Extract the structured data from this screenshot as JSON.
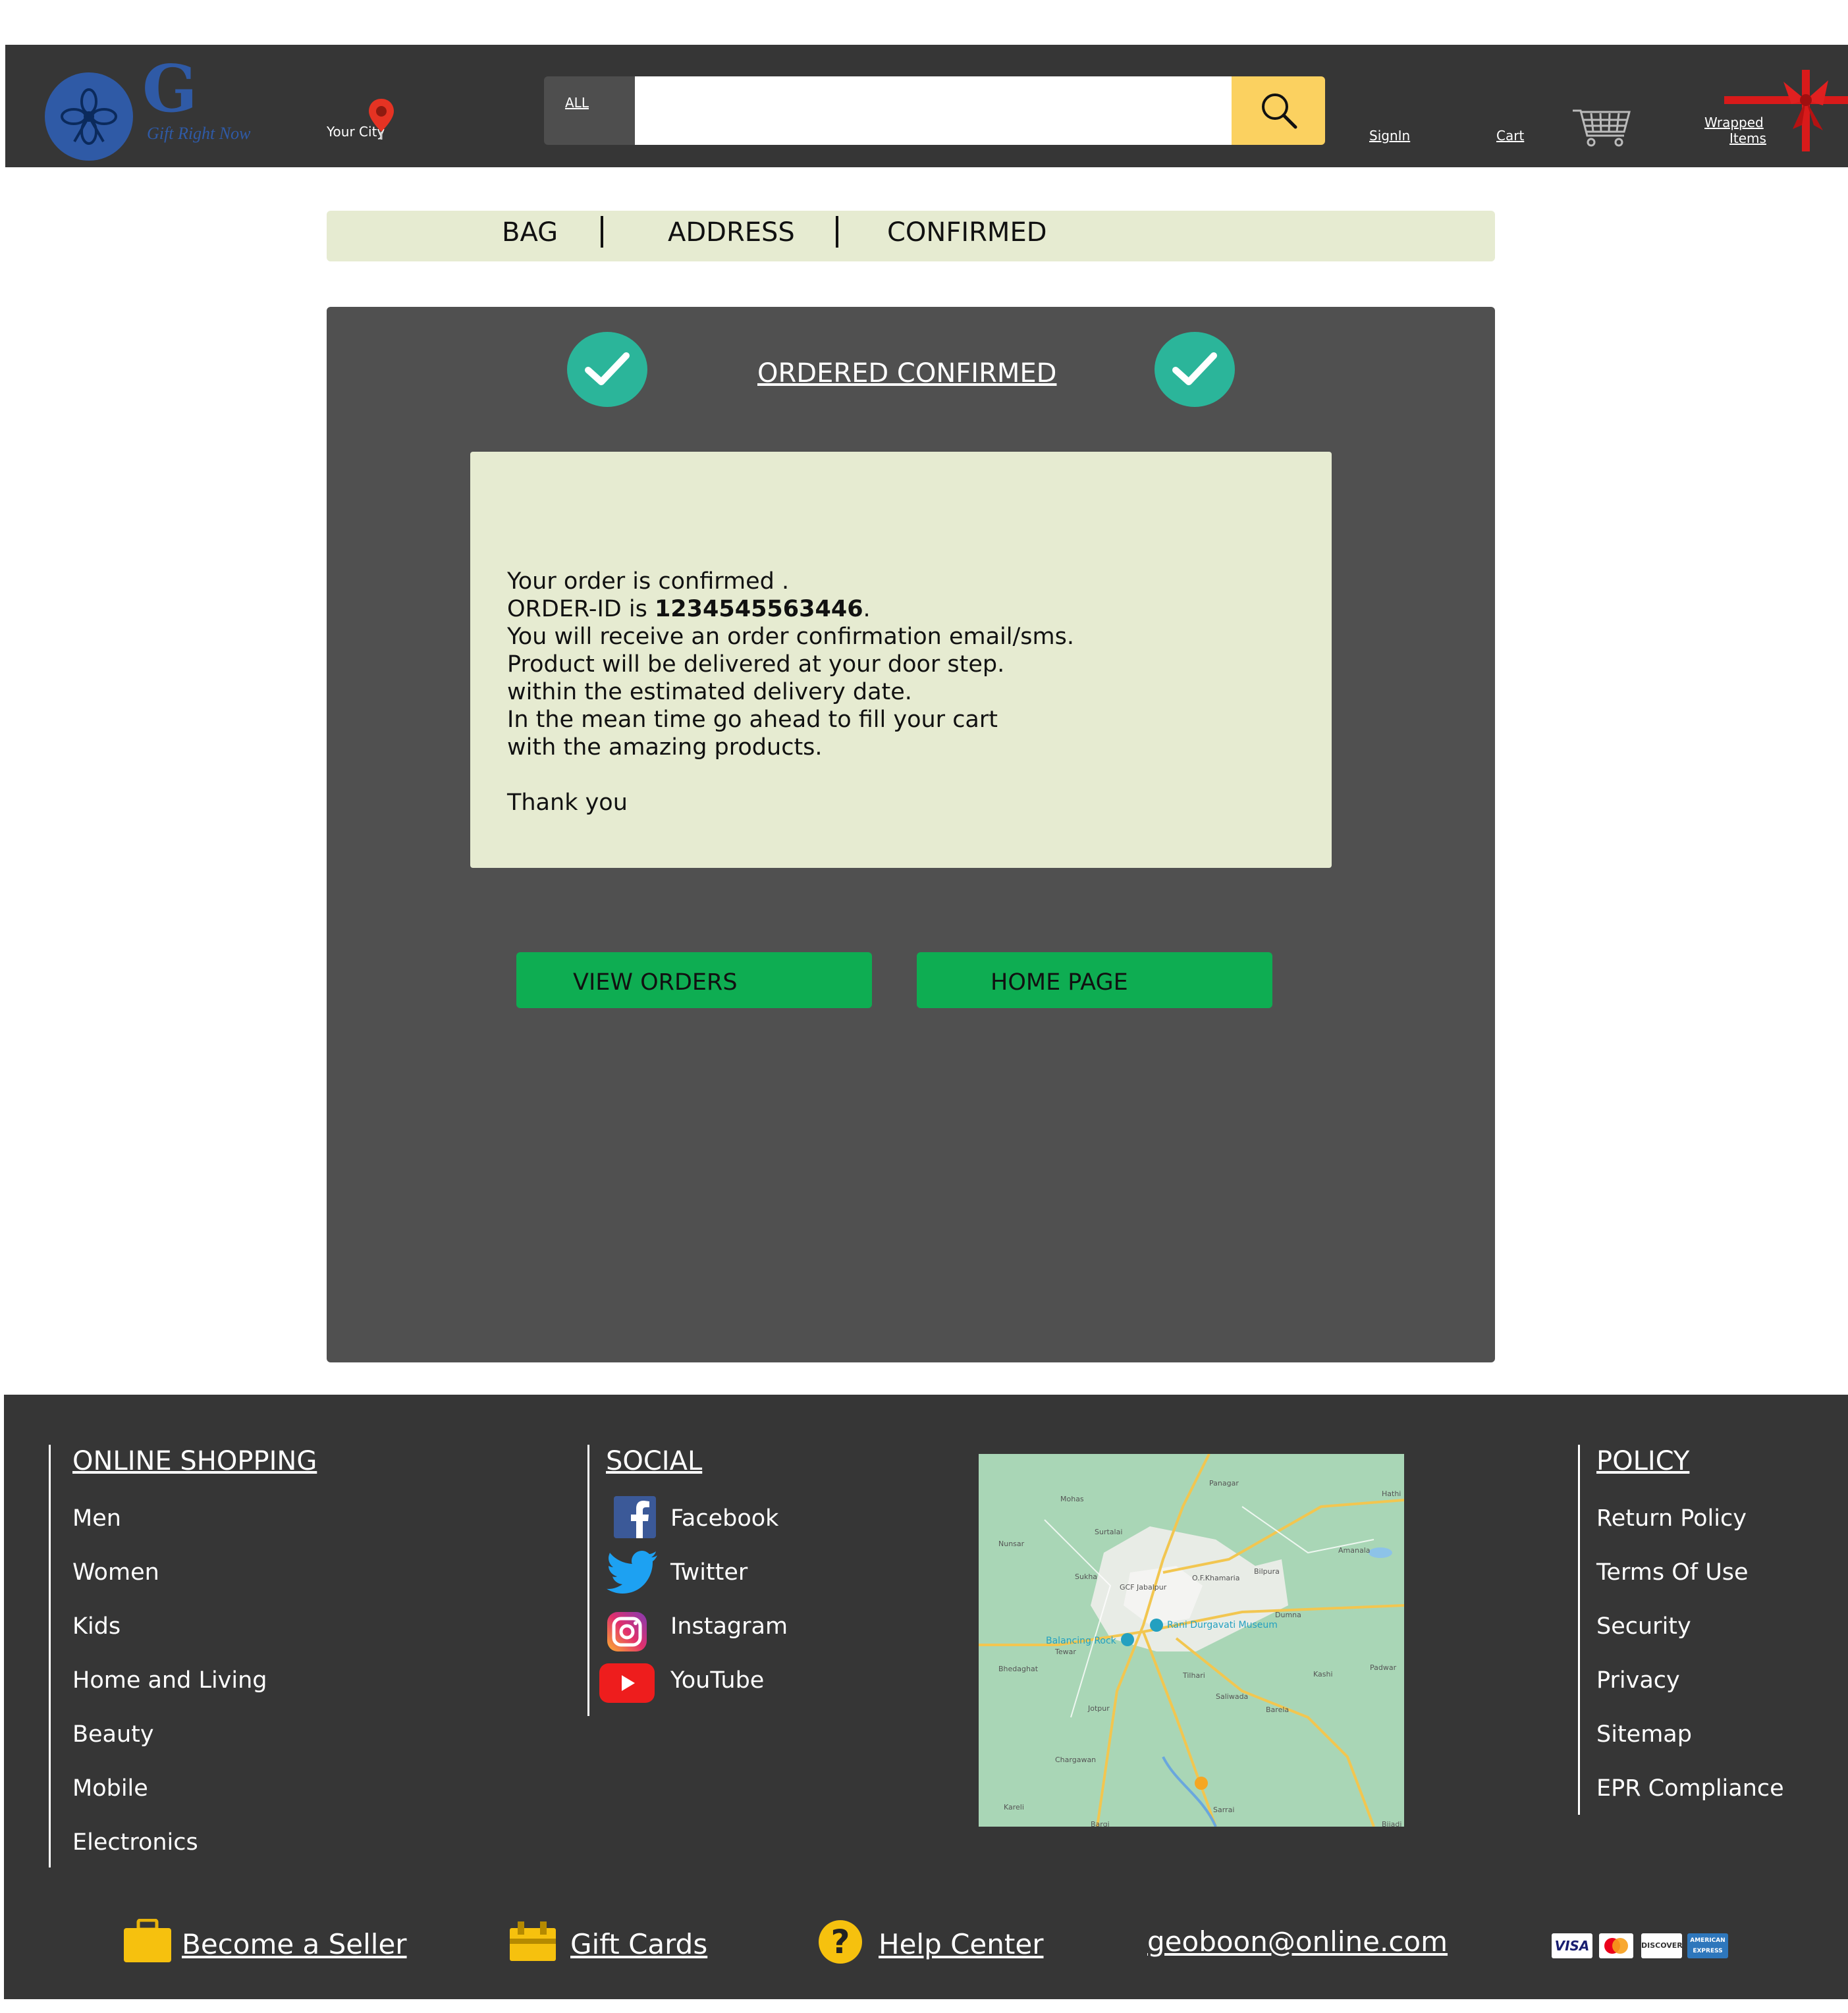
{
  "header": {
    "logo_letter": "G",
    "logo_tagline": "Gift Right Now",
    "city_label": "Your City",
    "search_category": "ALL",
    "search_value": "",
    "signin_label": "SignIn",
    "cart_label": "Cart",
    "wrapped_label_1": "Wrapped",
    "wrapped_label_2": "Items"
  },
  "stepper": {
    "steps": [
      "BAG",
      "ADDRESS",
      "CONFIRMED"
    ]
  },
  "confirmation": {
    "title": "ORDERED CONFIRMED",
    "line1": "Your order is confirmed .",
    "order_prefix": "ORDER-ID  is ",
    "order_id": "1234545563446",
    "order_suffix": ".",
    "line3": "You will receive an order confirmation email/sms.",
    "line4": "Product will be delivered at your door step.",
    "line5": "within the estimated delivery date.",
    "line6": "In the mean time go ahead to fill your cart",
    "line7": "with the amazing products.",
    "line8": "Thank you",
    "view_orders_label": "VIEW ORDERS",
    "home_page_label": "HOME PAGE"
  },
  "footer": {
    "online_shopping": {
      "heading": "ONLINE SHOPPING",
      "items": [
        "Men",
        "Women",
        "Kids",
        "Home and Living",
        "Beauty",
        "Mobile",
        "Electronics"
      ]
    },
    "social": {
      "heading": "SOCIAL",
      "items": [
        "Facebook",
        "Twitter",
        "Instagram",
        "YouTube"
      ]
    },
    "map_labels": [
      "Mohas",
      "Panagar",
      "Surtalai",
      "Nunsar",
      "Amanala",
      "Bilpura",
      "O.F.Khamaria",
      "Sukha",
      "GCF Jabalpur",
      "Dumna",
      "Rani Durgavati Museum",
      "Balancing Rock",
      "Tewar",
      "Bhedaghat",
      "Tilhari",
      "Saliwada",
      "Barela",
      "Kashi",
      "Padwar",
      "Jotpur",
      "Chargawan",
      "Kareli",
      "Sarrai",
      "Bargi",
      "Bijadi",
      "Hathi"
    ],
    "policy": {
      "heading": "POLICY",
      "items": [
        "Return Policy",
        "Terms Of Use",
        "Security",
        "Privacy",
        "Sitemap",
        "EPR Compliance"
      ]
    },
    "bottom": {
      "seller": "Become a Seller",
      "gift_cards": "Gift Cards",
      "help": "Help Center",
      "email": "geoboon@online.com"
    },
    "payments": [
      "VISA",
      "MasterCard",
      "DISCOVER",
      "AMERICAN EXPRESS"
    ]
  },
  "colors": {
    "header_bg": "#363636",
    "search_button": "#fbd160",
    "stepper_bg": "#e6ebd1",
    "panel_bg": "#505050",
    "check_green": "#2bb59a",
    "button_green": "#0ead52",
    "logo_blue": "#2f5aa6"
  }
}
